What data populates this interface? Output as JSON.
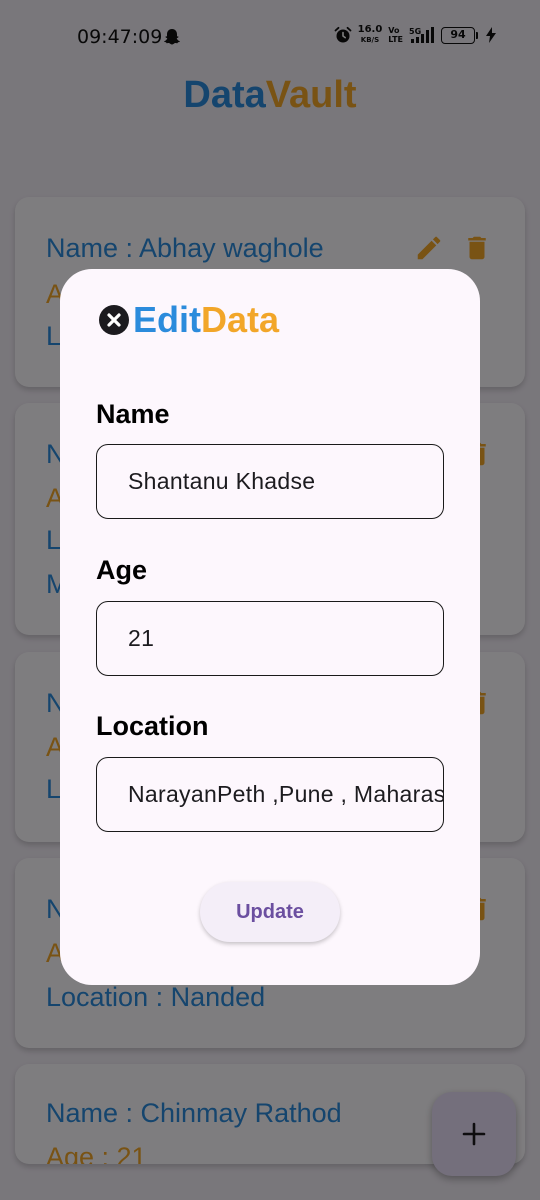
{
  "status_bar": {
    "time": "09:47:09",
    "net_speed_value": "16.0",
    "net_speed_unit": "KB/S",
    "volte_top": "Vo",
    "volte_bottom": "LTE",
    "battery": "94",
    "icons": [
      "snapchat-icon",
      "alarm-icon",
      "signal-5g-icon",
      "battery-icon",
      "charging-bolt-icon"
    ]
  },
  "app": {
    "title_part1": "Data",
    "title_part2": "Vault",
    "colors": {
      "blue": "#2b8bdc",
      "orange": "#f2a629",
      "accent_purple": "#6b4fa0"
    }
  },
  "cards": [
    {
      "name": "Name : Abhay waghole",
      "age": "A",
      "location": "L"
    },
    {
      "name": "N",
      "age": "A",
      "location": "L",
      "extra": "M"
    },
    {
      "name": "N",
      "age": "A",
      "location": "L"
    },
    {
      "name": "N",
      "age": "A",
      "location": "Location : Nanded"
    },
    {
      "name": "Name : Chinmay Rathod",
      "age": "Age : 21"
    }
  ],
  "dialog": {
    "title_part1": "Edit",
    "title_part2": "Data",
    "name_label": "Name",
    "name_value": "Shantanu Khadse",
    "age_label": "Age",
    "age_value": "21",
    "location_label": "Location",
    "location_value": "NarayanPeth ,Pune , Maharashtra",
    "update_label": "Update"
  },
  "fab": {
    "label": "+"
  }
}
